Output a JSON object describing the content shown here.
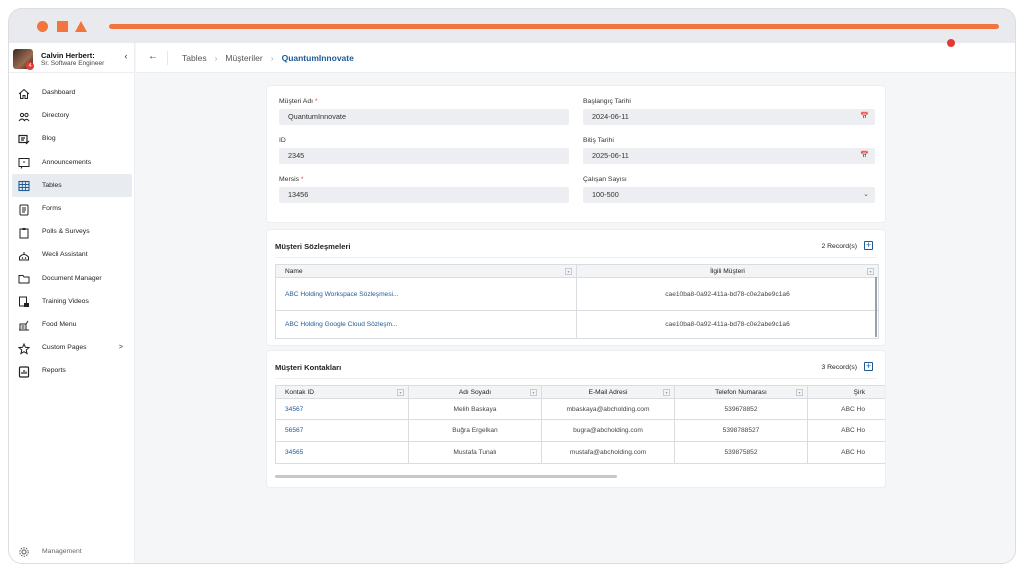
{
  "user": {
    "name": "Calvin Herbert:",
    "role": "Sr. Software Engineer",
    "badge": "4"
  },
  "sidebar": {
    "items": [
      {
        "label": "Dashboard",
        "icon": "home-icon"
      },
      {
        "label": "Directory",
        "icon": "people-icon"
      },
      {
        "label": "Blog",
        "icon": "blog-icon"
      },
      {
        "label": "Announcements",
        "icon": "megaphone-icon"
      },
      {
        "label": "Tables",
        "icon": "table-icon",
        "active": true
      },
      {
        "label": "Forms",
        "icon": "form-icon"
      },
      {
        "label": "Polls & Surveys",
        "icon": "clipboard-icon"
      },
      {
        "label": "Wecli Assistant",
        "icon": "bot-icon"
      },
      {
        "label": "Document Manager",
        "icon": "folder-icon"
      },
      {
        "label": "Training Videos",
        "icon": "video-icon"
      },
      {
        "label": "Food Menu",
        "icon": "food-icon"
      },
      {
        "label": "Custom Pages",
        "icon": "star-icon"
      },
      {
        "label": "Reports",
        "icon": "report-icon"
      }
    ],
    "custom_pages_arrow": ">",
    "management": "Management"
  },
  "breadcrumb": {
    "items": [
      "Tables",
      "Müşteriler",
      "QuantumInnovate"
    ]
  },
  "form": {
    "musteri_adi": {
      "label": "Müşteri Adı",
      "value": "QuantumInnovate"
    },
    "baslangic": {
      "label": "Başlangıç Tarihi",
      "value": "2024-06-11"
    },
    "id": {
      "label": "ID",
      "value": "2345"
    },
    "bitis": {
      "label": "Bitiş Tarihi",
      "value": "2025-06-11"
    },
    "mersis": {
      "label": "Mersis",
      "value": "13456"
    },
    "calisan": {
      "label": "Çalışan Sayısı",
      "value": "100-500"
    }
  },
  "contracts": {
    "title": "Müşteri Sözleşmeleri",
    "count": "2 Record(s)",
    "headers": [
      "Name",
      "İlgili Müşteri"
    ],
    "rows": [
      [
        "ABC Holding Workspace Sözleşmesi...",
        "cae10ba8-0a92-411a-bd78-c0e2abe9c1a6"
      ],
      [
        "ABC Holding Google Cloud Sözleşm...",
        "cae10ba8-0a92-411a-bd78-c0e2abe9c1a6"
      ]
    ]
  },
  "contacts": {
    "title": "Müşteri Kontakları",
    "count": "3 Record(s)",
    "headers": [
      "Kontak ID",
      "Adı Soyadı",
      "E-Mail Adresi",
      "Telefon Numarası",
      "Şirk"
    ],
    "rows": [
      [
        "34567",
        "Melih Baskaya",
        "mbaskaya@abcholding.com",
        "539678852",
        "ABC Ho"
      ],
      [
        "56567",
        "Buğra Ergelkan",
        "bugra@abcholding.com",
        "5398788527",
        "ABC Ho"
      ],
      [
        "34565",
        "Mustafa Tunalı",
        "mustafa@abcholding.com",
        "539875852",
        "ABC Ho"
      ]
    ]
  }
}
